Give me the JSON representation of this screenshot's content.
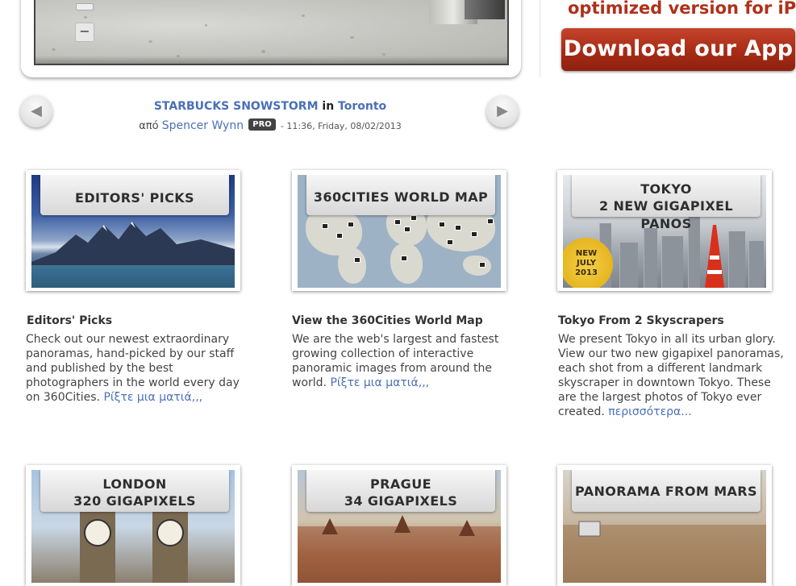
{
  "promo": {
    "tagline": "optimized version for iPad",
    "download_label": "Download our App",
    "accent": "#b0301a"
  },
  "viewer": {
    "zoom_out_symbol": "−"
  },
  "navigation": {
    "prev_symbol": "◀",
    "next_symbol": "▶"
  },
  "panorama": {
    "title": "STARBUCKS SNOWSTORM",
    "in_word": "in",
    "location": "Toronto",
    "by_word": "από",
    "author": "Spencer Wynn",
    "badge": "PRO",
    "timestamp": "- 11:36, Friday, 08/02/2013"
  },
  "features": [
    {
      "banner": [
        "EDITORS' PICKS"
      ],
      "heading": "Editors' Picks",
      "text": "Check out our newest extraordinary panoramas, hand-picked by our staff and published by the best photographers in the world every day on 360Cities.",
      "link": "Ρίξτε μια ματιά,,,"
    },
    {
      "banner": [
        "360CITIES WORLD MAP"
      ],
      "heading": "View the 360Cities World Map",
      "text": "We are the web's largest and fastest growing collection of interactive panoramic images from around the world.",
      "link": "Ρίξτε μια ματιά,,,"
    },
    {
      "banner": [
        "TOKYO",
        "2 NEW GIGAPIXEL PANOS"
      ],
      "seal": [
        "NEW",
        "JULY",
        "2013"
      ],
      "heading": "Tokyo From 2 Skyscrapers",
      "text": "We present Tokyo in all its urban glory. View our two new gigapixel panoramas, each shot from a different landmark skyscraper in downtown Tokyo. These are the largest photos of Tokyo ever created.",
      "link": "περισσότερα..."
    },
    {
      "banner": [
        "LONDON",
        "320 GIGAPIXELS"
      ]
    },
    {
      "banner": [
        "PRAGUE",
        "34 GIGAPIXELS"
      ]
    },
    {
      "banner": [
        "PANORAMA FROM MARS"
      ]
    }
  ]
}
